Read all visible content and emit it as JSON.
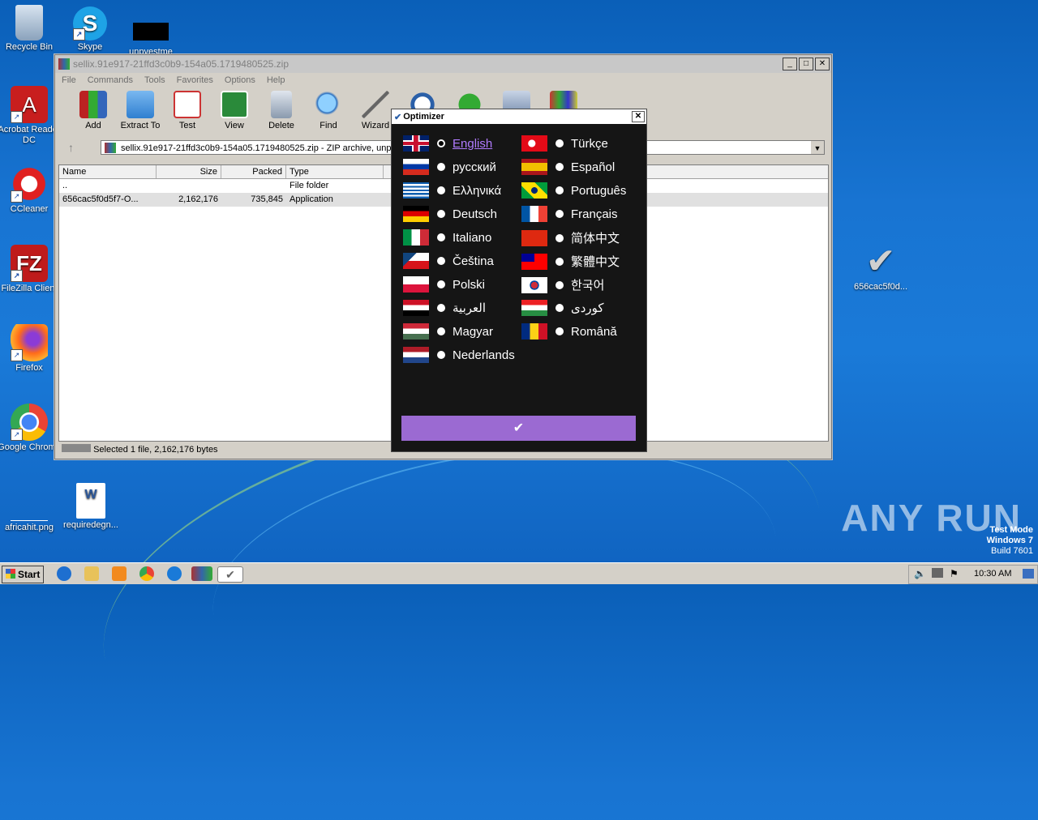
{
  "desktop": {
    "icons": [
      {
        "label": "Recycle Bin"
      },
      {
        "label": "Skype"
      },
      {
        "label": "unpvestme"
      },
      {
        "label": "Acrobat Reader DC"
      },
      {
        "label": "CCleaner"
      },
      {
        "label": "FileZilla Client"
      },
      {
        "label": "Firefox"
      },
      {
        "label": "Google Chrome"
      },
      {
        "label": "africahit.png"
      },
      {
        "label": "requiredegn..."
      },
      {
        "label": "656cac5f0d..."
      }
    ]
  },
  "winrar": {
    "title": "sellix.91e917-21ffd3c0b9-154a05.1719480525.zip",
    "menu": [
      "File",
      "Commands",
      "Tools",
      "Favorites",
      "Options",
      "Help"
    ],
    "toolbar": [
      "Add",
      "Extract To",
      "Test",
      "View",
      "Delete",
      "Find",
      "Wizard"
    ],
    "path": "sellix.91e917-21ffd3c0b9-154a05.1719480525.zip - ZIP archive, unpa",
    "columns": [
      "Name",
      "Size",
      "Packed",
      "Type"
    ],
    "rows": [
      {
        "name": "..",
        "size": "",
        "packed": "",
        "type": "File folder"
      },
      {
        "name": "656cac5f0d5f7-O...",
        "size": "2,162,176",
        "packed": "735,845",
        "type": "Application"
      }
    ],
    "status": "Selected 1 file, 2,162,176 bytes"
  },
  "optimizer": {
    "title": "Optimizer",
    "languages_left": [
      "English",
      "русский",
      "Ελληνικά",
      "Deutsch",
      "Italiano",
      "Čeština",
      "Polski",
      "العربية",
      "Magyar",
      "Nederlands"
    ],
    "languages_right": [
      "Türkçe",
      "Español",
      "Português",
      "Français",
      "简体中文",
      "繁體中文",
      "한국어",
      "كوردى",
      "Română"
    ],
    "selected": "English",
    "ok_label": "✔"
  },
  "taskbar": {
    "start_label": "Start",
    "clock": "10:30 AM"
  },
  "watermark": "ANY RUN",
  "testmode": [
    "Test Mode",
    "Windows 7",
    "Build 7601"
  ]
}
